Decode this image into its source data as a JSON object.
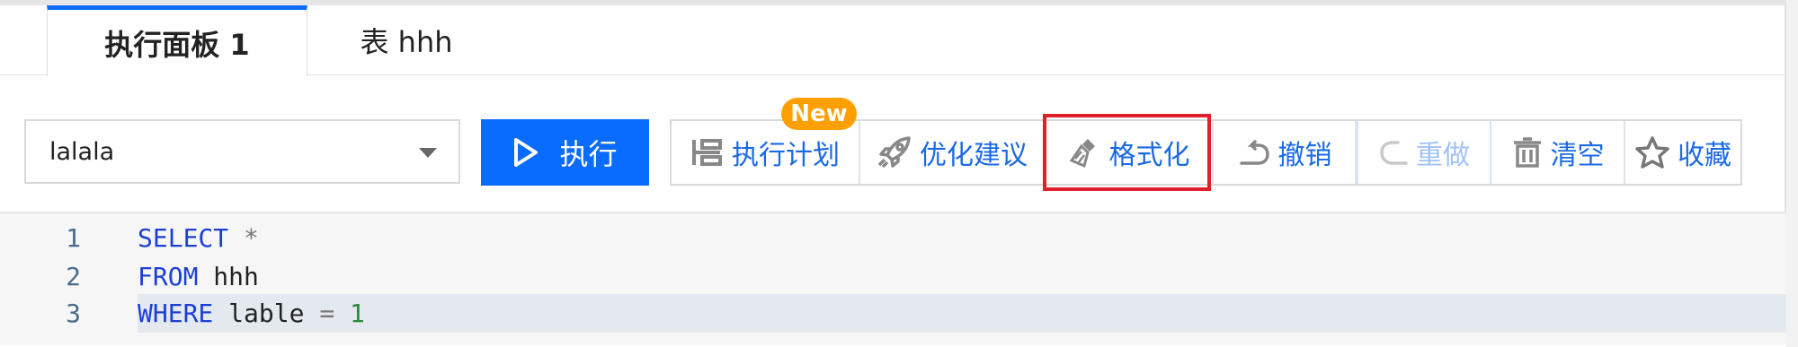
{
  "tabs": [
    {
      "label": "执行面板 1",
      "active": true
    },
    {
      "label": "表 hhh",
      "active": false
    }
  ],
  "toolbar": {
    "database": "lalala",
    "run_label": "执行",
    "badge": "New",
    "buttons": [
      {
        "label": "执行计划",
        "icon": "plan-icon",
        "disabled": false
      },
      {
        "label": "优化建议",
        "icon": "rocket-icon",
        "disabled": false
      },
      {
        "label": "格式化",
        "icon": "brush-icon",
        "disabled": false
      },
      {
        "label": "撤销",
        "icon": "undo-icon",
        "disabled": false
      },
      {
        "label": "重做",
        "icon": "redo-icon",
        "disabled": true
      },
      {
        "label": "清空",
        "icon": "trash-icon",
        "disabled": false
      },
      {
        "label": "收藏",
        "icon": "star-icon",
        "disabled": false
      }
    ]
  },
  "editor": {
    "lines": [
      {
        "num": "1",
        "tokens": [
          {
            "t": "SELECT",
            "k": "kw"
          },
          {
            "t": " ",
            "k": "plain"
          },
          {
            "t": "*",
            "k": "op"
          }
        ]
      },
      {
        "num": "2",
        "tokens": [
          {
            "t": "FROM",
            "k": "kw"
          },
          {
            "t": " hhh",
            "k": "plain"
          }
        ]
      },
      {
        "num": "3",
        "tokens": [
          {
            "t": "WHERE",
            "k": "kw"
          },
          {
            "t": " lable ",
            "k": "plain"
          },
          {
            "t": "=",
            "k": "op"
          },
          {
            "t": " ",
            "k": "plain"
          },
          {
            "t": "1",
            "k": "num-lit"
          }
        ]
      }
    ]
  },
  "colors": {
    "accent": "#0a6cff",
    "highlight": "#e0202a",
    "badge": "#ff9f00"
  }
}
